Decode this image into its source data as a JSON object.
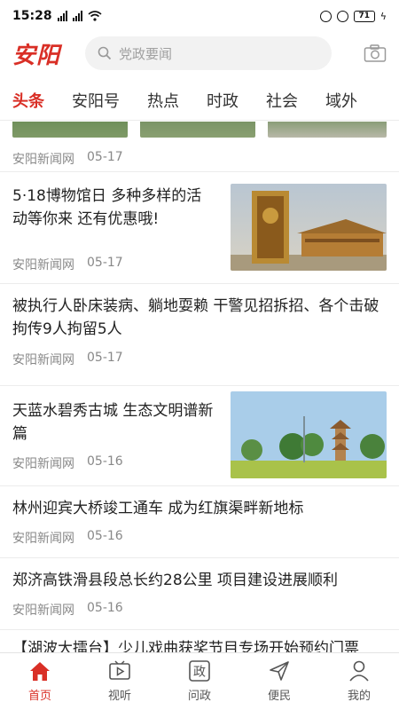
{
  "status_bar": {
    "time": "15:28",
    "battery": "71"
  },
  "header": {
    "logo": "安阳",
    "search_placeholder": "党政要闻"
  },
  "tabs": [
    {
      "label": "头条",
      "active": true
    },
    {
      "label": "安阳号",
      "active": false
    },
    {
      "label": "热点",
      "active": false
    },
    {
      "label": "时政",
      "active": false
    },
    {
      "label": "社会",
      "active": false
    },
    {
      "label": "域外",
      "active": false
    }
  ],
  "feed": {
    "partial_item": {
      "source": "安阳新闻网",
      "date": "05-17"
    },
    "items": [
      {
        "title": "5·18博物馆日 多种多样的活动等你来 还有优惠哦!",
        "source": "安阳新闻网",
        "date": "05-17",
        "has_image": true
      },
      {
        "title": "被执行人卧床装病、躺地耍赖 干警见招拆招、各个击破拘传9人拘留5人",
        "source": "安阳新闻网",
        "date": "05-17",
        "has_image": false
      },
      {
        "title": "天蓝水碧秀古城 生态文明谱新篇",
        "source": "安阳新闻网",
        "date": "05-16",
        "has_image": true
      },
      {
        "title": "林州迎宾大桥竣工通车 成为红旗渠畔新地标",
        "source": "安阳新闻网",
        "date": "05-16",
        "has_image": false
      },
      {
        "title": "郑济高铁滑县段总长约28公里 项目建设进展顺利",
        "source": "安阳新闻网",
        "date": "05-16",
        "has_image": false
      },
      {
        "title": "【湖波大擂台】少儿戏曲获奖节目专场开始预约门票",
        "source": "",
        "date": "",
        "has_image": false
      }
    ]
  },
  "bottom_nav": [
    {
      "label": "首页",
      "icon": "home-icon",
      "active": true
    },
    {
      "label": "视听",
      "icon": "video-icon",
      "active": false
    },
    {
      "label": "问政",
      "icon": "politics-icon",
      "active": false
    },
    {
      "label": "便民",
      "icon": "send-icon",
      "active": false
    },
    {
      "label": "我的",
      "icon": "user-icon",
      "active": false
    }
  ],
  "colors": {
    "accent": "#d92f26",
    "text": "#222222",
    "meta": "#888888",
    "divider": "#ececec"
  }
}
